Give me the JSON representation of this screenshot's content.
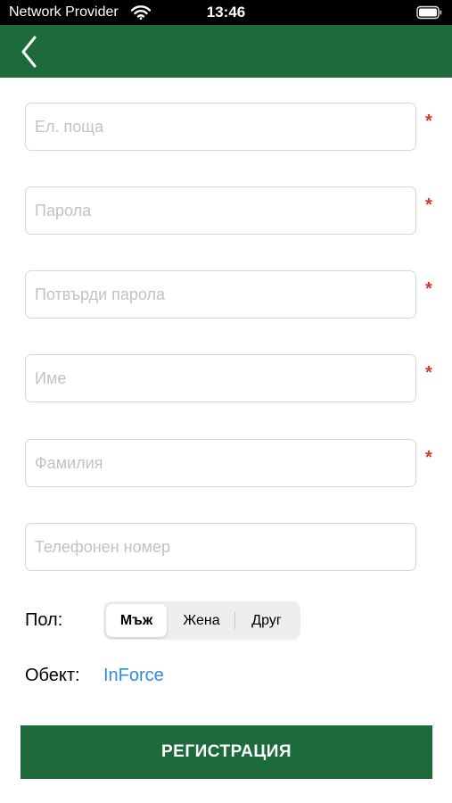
{
  "status_bar": {
    "carrier": "Network Provider",
    "time": "13:46",
    "wifi_icon": "wifi-icon",
    "battery_icon": "battery-icon"
  },
  "nav": {
    "back_icon": "chevron-left-icon"
  },
  "form": {
    "fields": [
      {
        "placeholder": "Ел. поща",
        "value": "",
        "required_mark": "*"
      },
      {
        "placeholder": "Парола",
        "value": "",
        "required_mark": "*"
      },
      {
        "placeholder": "Потвърди парола",
        "value": "",
        "required_mark": "*"
      },
      {
        "placeholder": "Име",
        "value": "",
        "required_mark": "*"
      },
      {
        "placeholder": "Фамилия",
        "value": "",
        "required_mark": "*"
      },
      {
        "placeholder": "Телефонен номер",
        "value": ""
      }
    ],
    "gender": {
      "label": "Пол:",
      "options": [
        "Мъж",
        "Жена",
        "Друг"
      ],
      "selected": "Мъж"
    },
    "object": {
      "label": "Обект:",
      "value": "InForce"
    },
    "submit_label": "РЕГИСТРАЦИЯ"
  },
  "colors": {
    "brand_green": "#1d6b3a",
    "required_red": "#e53427",
    "link_blue": "#2a8de0"
  }
}
